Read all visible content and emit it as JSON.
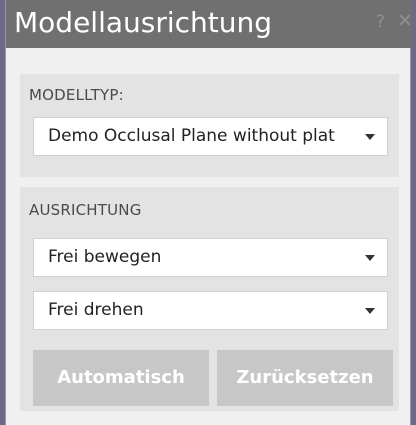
{
  "window": {
    "title": "Modellausrichtung",
    "help_glyph": "?",
    "close_glyph": "✕"
  },
  "modelltyp": {
    "label": "MODELLTYP:",
    "selected": "Demo Occlusal Plane without plat"
  },
  "ausrichtung": {
    "label": "AUSRICHTUNG",
    "move_selected": "Frei bewegen",
    "rotate_selected": "Frei drehen",
    "auto_button": "Automatisch",
    "reset_button": "Zurücksetzen"
  },
  "colors": {
    "titlebar": "#707070",
    "panel": "#f0f0f0",
    "section": "#e3e3e3",
    "button": "#c7c7c7",
    "background": "#6e6a86"
  }
}
